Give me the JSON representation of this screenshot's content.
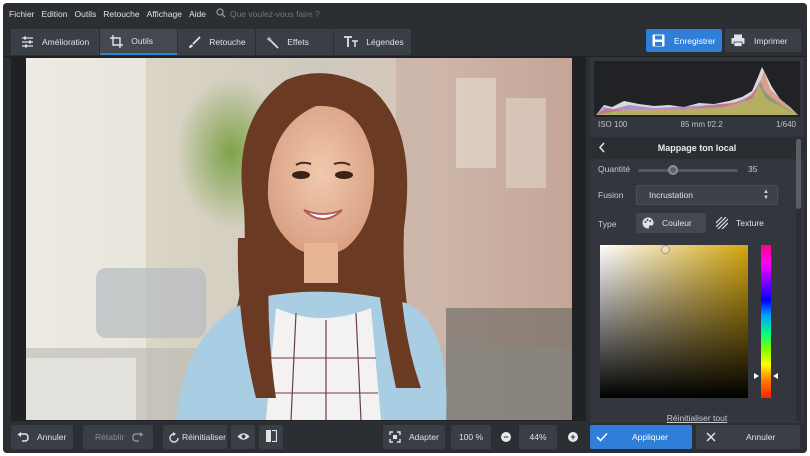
{
  "menubar": {
    "items": [
      "Fichier",
      "Edition",
      "Outils",
      "Retouche",
      "Affichage",
      "Aide"
    ],
    "search_placeholder": "Que voulez-vous faire ?"
  },
  "toolbar": {
    "tabs": [
      {
        "label": "Amélioration",
        "icon": "sliders-icon"
      },
      {
        "label": "Outils",
        "icon": "crop-icon"
      },
      {
        "label": "Retouche",
        "icon": "brush-icon"
      },
      {
        "label": "Effets",
        "icon": "magic-wand-icon"
      },
      {
        "label": "Légendes",
        "icon": "text-icon"
      }
    ],
    "active_tab": "Outils",
    "save_label": "Enregistrer",
    "print_label": "Imprimer",
    "accent_color": "#2f7ed8"
  },
  "panel": {
    "exif": {
      "iso": "ISO 100",
      "lens": "85 mm f/2.2",
      "shutter": "1/640"
    },
    "title": "Mappage ton local",
    "quantite_label": "Quantité",
    "quantite_value": "35",
    "quantite_level_percent": 35,
    "fusion_label": "Fusion",
    "fusion_value": "Incrustation",
    "type_label": "Type",
    "type_couleur": "Couleur",
    "type_texture": "Texture",
    "picker_base_color": "#d4a60e",
    "reset_all": "Réinitialiser tout"
  },
  "bottombar": {
    "undo": "Annuler",
    "redo": "Rétablir",
    "reset": "Réinitialiser",
    "fit": "Adapter",
    "zoom_100": "100 %",
    "zoom": "44%",
    "apply": "Appliquer",
    "cancel": "Annuler"
  }
}
